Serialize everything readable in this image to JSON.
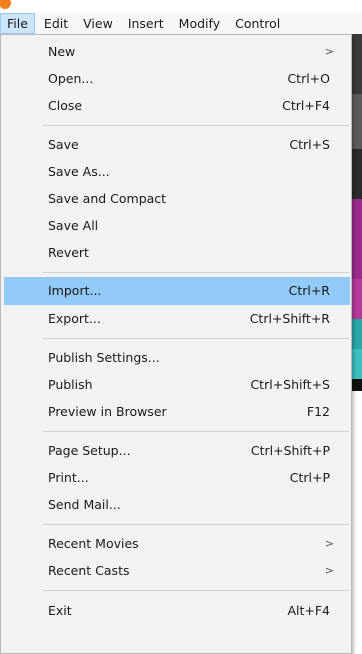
{
  "app": {
    "accent_color": "#f47f20",
    "icon": "app-logo-icon"
  },
  "menubar": {
    "items": [
      "File",
      "Edit",
      "View",
      "Insert",
      "Modify",
      "Control"
    ],
    "active": "File"
  },
  "file_menu": {
    "highlight_color": "#91c9f7",
    "items": [
      {
        "label": "New",
        "shortcut": "",
        "submenu": true
      },
      {
        "label": "Open...",
        "shortcut": "Ctrl+O"
      },
      {
        "label": "Close",
        "shortcut": "Ctrl+F4"
      },
      {
        "label": "Save",
        "shortcut": "Ctrl+S"
      },
      {
        "label": "Save As...",
        "shortcut": ""
      },
      {
        "label": "Save and Compact",
        "shortcut": ""
      },
      {
        "label": "Save All",
        "shortcut": ""
      },
      {
        "label": "Revert",
        "shortcut": ""
      },
      {
        "label": "Import...",
        "shortcut": "Ctrl+R",
        "highlighted": true
      },
      {
        "label": "Export...",
        "shortcut": "Ctrl+Shift+R"
      },
      {
        "label": "Publish Settings...",
        "shortcut": ""
      },
      {
        "label": "Publish",
        "shortcut": "Ctrl+Shift+S"
      },
      {
        "label": "Preview in Browser",
        "shortcut": "F12"
      },
      {
        "label": "Page Setup...",
        "shortcut": "Ctrl+Shift+P"
      },
      {
        "label": "Print...",
        "shortcut": "Ctrl+P"
      },
      {
        "label": "Send Mail...",
        "shortcut": ""
      },
      {
        "label": "Recent Movies",
        "shortcut": "",
        "submenu": true
      },
      {
        "label": "Recent Casts",
        "shortcut": "",
        "submenu": true
      },
      {
        "label": "Exit",
        "shortcut": "Alt+F4"
      }
    ],
    "submenu_arrow": ">"
  }
}
